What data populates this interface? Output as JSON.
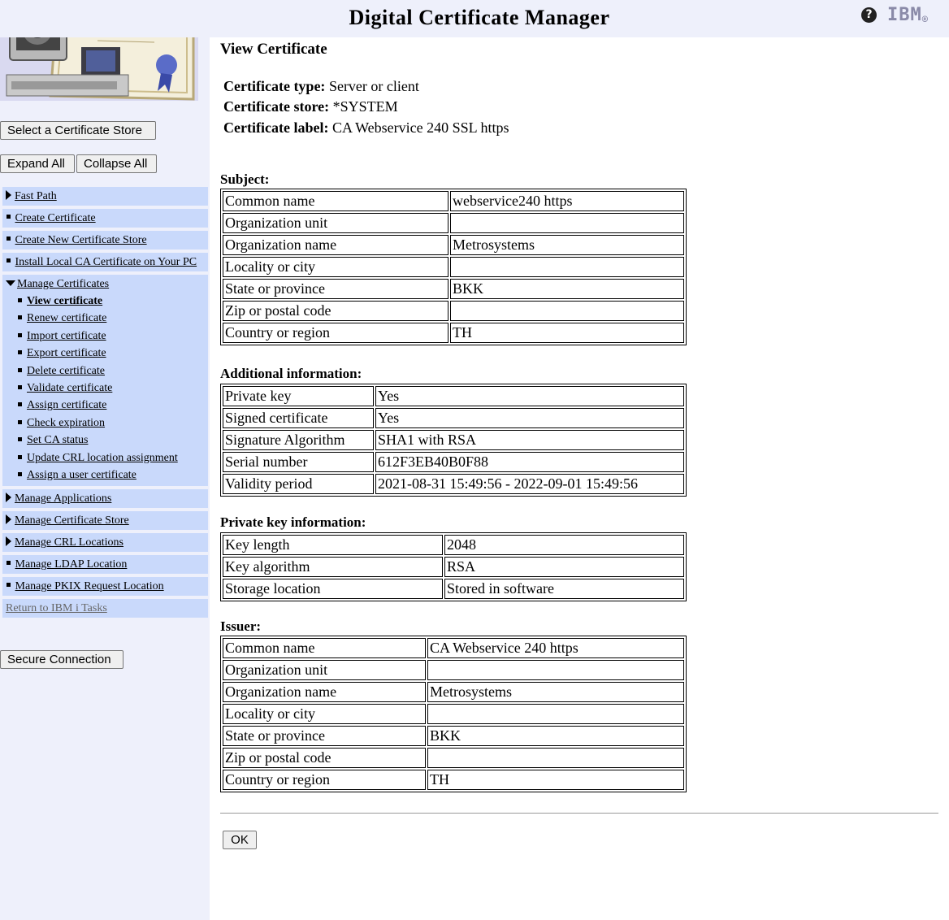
{
  "header": {
    "title": "Digital Certificate Manager",
    "help_icon": "question-circle-icon",
    "logo_text": "IBM",
    "logo_mark": "®"
  },
  "sidebar": {
    "logo_image": "certificate-with-computer-illustration",
    "select_store_label": "Select a Certificate Store",
    "expand_all_label": "Expand All",
    "collapse_all_label": "Collapse All",
    "nav": [
      {
        "label": "Fast Path",
        "marker": "triangle-right"
      },
      {
        "label": "Create Certificate",
        "marker": "square"
      },
      {
        "label": "Create New Certificate Store",
        "marker": "square"
      },
      {
        "label": "Install Local CA Certificate on Your PC",
        "marker": "square"
      },
      {
        "label": "Manage Certificates",
        "marker": "triangle-down",
        "children": [
          "View certificate",
          "Renew certificate",
          "Import certificate",
          "Export certificate",
          "Delete certificate",
          "Validate certificate",
          "Assign certificate",
          "Check expiration",
          "Set CA status",
          "Update CRL location assignment",
          "Assign a user certificate"
        ],
        "active_child": "View certificate"
      },
      {
        "label": "Manage Applications",
        "marker": "triangle-right"
      },
      {
        "label": "Manage Certificate Store",
        "marker": "triangle-right"
      },
      {
        "label": "Manage CRL Locations",
        "marker": "triangle-right"
      },
      {
        "label": "Manage LDAP Location",
        "marker": "square"
      },
      {
        "label": "Manage PKIX Request Location",
        "marker": "square"
      },
      {
        "label": "Return to IBM i Tasks",
        "marker": "none"
      }
    ],
    "secure_connection_label": "Secure Connection"
  },
  "main": {
    "heading": "View Certificate",
    "meta": [
      {
        "label": "Certificate type:",
        "value": "Server or client"
      },
      {
        "label": "Certificate store:",
        "value": "*SYSTEM"
      },
      {
        "label": "Certificate label:",
        "value": "CA Webservice 240 SSL https"
      }
    ],
    "subject": {
      "title": "Subject:",
      "rows": [
        [
          "Common name",
          "webservice240 https"
        ],
        [
          "Organization unit",
          ""
        ],
        [
          "Organization name",
          "Metrosystems"
        ],
        [
          "Locality or city",
          ""
        ],
        [
          "State or province",
          "BKK"
        ],
        [
          "Zip or postal code",
          ""
        ],
        [
          "Country or region",
          "TH"
        ]
      ]
    },
    "additional": {
      "title": "Additional information:",
      "rows": [
        [
          "Private key",
          "Yes"
        ],
        [
          "Signed certificate",
          "Yes"
        ],
        [
          "Signature Algorithm",
          "SHA1 with RSA"
        ],
        [
          "Serial number",
          "612F3EB40B0F88"
        ],
        [
          "Validity period",
          "2021-08-31 15:49:56 - 2022-09-01 15:49:56"
        ]
      ]
    },
    "private_key": {
      "title": "Private key information:",
      "rows": [
        [
          "Key length",
          "2048"
        ],
        [
          "Key algorithm",
          "RSA"
        ],
        [
          "Storage location",
          "Stored in software"
        ]
      ]
    },
    "issuer": {
      "title": "Issuer:",
      "rows": [
        [
          "Common name",
          "CA Webservice 240 https"
        ],
        [
          "Organization unit",
          ""
        ],
        [
          "Organization name",
          "Metrosystems"
        ],
        [
          "Locality or city",
          ""
        ],
        [
          "State or province",
          "BKK"
        ],
        [
          "Zip or postal code",
          ""
        ],
        [
          "Country or region",
          "TH"
        ]
      ]
    },
    "ok_label": "OK"
  }
}
